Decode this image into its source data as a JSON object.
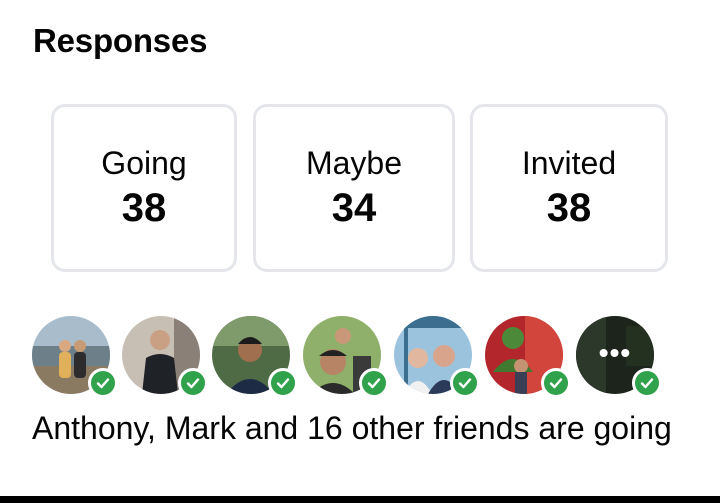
{
  "section_title": "Responses",
  "stats": [
    {
      "label": "Going",
      "count": "38"
    },
    {
      "label": "Maybe",
      "count": "34"
    },
    {
      "label": "Invited",
      "count": "38"
    }
  ],
  "avatars": [
    {
      "name": "friend-1",
      "status": "going"
    },
    {
      "name": "friend-2",
      "status": "going"
    },
    {
      "name": "friend-3",
      "status": "going"
    },
    {
      "name": "friend-4",
      "status": "going"
    },
    {
      "name": "friend-5",
      "status": "going"
    },
    {
      "name": "friend-6",
      "status": "going"
    },
    {
      "name": "more",
      "status": "going",
      "icon": "more-dots-icon"
    }
  ],
  "friends_summary": "Anthony, Mark and 16 other friends are going",
  "colors": {
    "check_green": "#31a24c",
    "card_border": "#e4e6eb"
  }
}
